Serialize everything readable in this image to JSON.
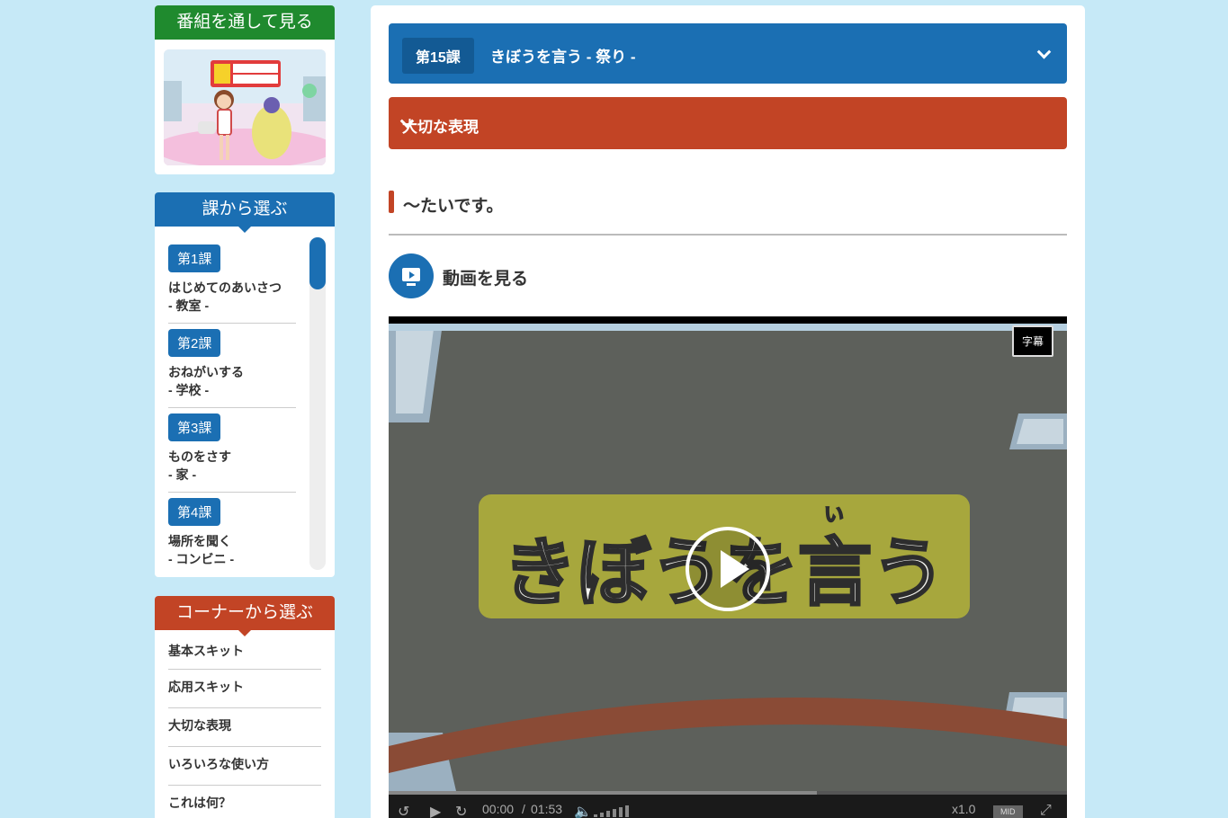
{
  "program_card": {
    "title": "番組を通して見る"
  },
  "lessons_card": {
    "title": "課から選ぶ",
    "items": [
      {
        "badge": "第1課",
        "name": "はじめてのあいさつ",
        "place": "- 教室 -"
      },
      {
        "badge": "第2課",
        "name": "おねがいする",
        "place": "- 学校 -"
      },
      {
        "badge": "第3課",
        "name": "ものをさす",
        "place": "- 家 -"
      },
      {
        "badge": "第4課",
        "name": "場所を聞く",
        "place": "- コンビニ -"
      }
    ]
  },
  "corner_card": {
    "title": "コーナーから選ぶ",
    "items": [
      "基本スキット",
      "応用スキット",
      "大切な表現",
      "いろいろな使い方",
      "これは何？"
    ]
  },
  "main": {
    "lesson_number": "第15課",
    "lesson_title": "きぼうを言う - 祭り -",
    "section_title": "大切な表現",
    "expression": "〜たいです。",
    "watch_label": "動画を見る"
  },
  "player": {
    "subtitle_button": "字幕",
    "current_time": "00:00",
    "separator": "/",
    "duration": "01:53",
    "speed": "x1.0",
    "quality": "MID",
    "title_card_text": "きぼうを言う",
    "furigana": "い"
  },
  "colors": {
    "blue": "#1b6fb3",
    "orange": "#c24425",
    "green": "#1f8a2e",
    "background": "#c6e9f7"
  }
}
